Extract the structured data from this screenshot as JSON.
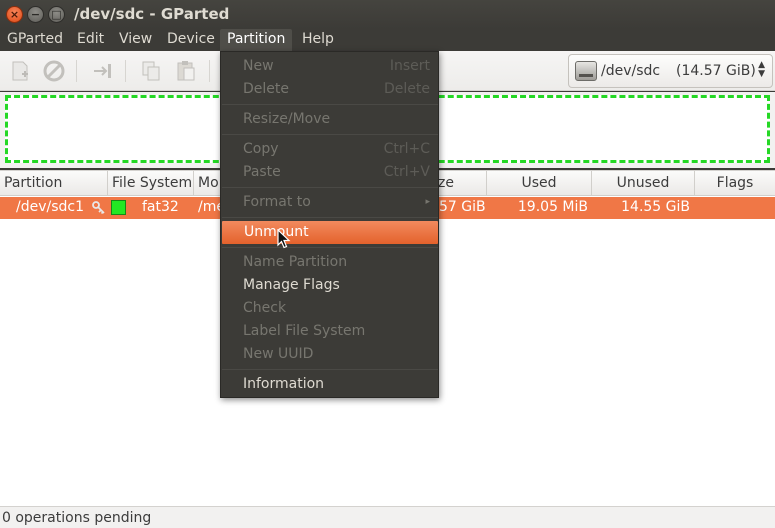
{
  "window": {
    "title": "/dev/sdc - GParted",
    "close_glyph": "×",
    "minimize_glyph": "−",
    "maximize_glyph": "□"
  },
  "menubar": [
    "GParted",
    "Edit",
    "View",
    "Device",
    "Partition",
    "Help"
  ],
  "toolbar": {
    "icons": [
      "new-partition-icon",
      "delete-icon",
      "resize-move-icon",
      "copy-icon",
      "paste-icon"
    ]
  },
  "device_selector": {
    "device": "/dev/sdc",
    "size": "(14.57 GiB)"
  },
  "table": {
    "columns": [
      "Partition",
      "File System",
      "Mo",
      "ze",
      "Used",
      "Unused",
      "Flags"
    ],
    "rows": [
      {
        "partition": "/dev/sdc1",
        "filesystem": "fat32",
        "mountpoint": "/me",
        "size": "57 GiB",
        "used": "19.05 MiB",
        "unused": "14.55 GiB",
        "flags": ""
      }
    ]
  },
  "partition_menu": {
    "new": {
      "label": "New",
      "accel": "Insert"
    },
    "delete": {
      "label": "Delete",
      "accel": "Delete"
    },
    "resize": {
      "label": "Resize/Move"
    },
    "copy": {
      "label": "Copy",
      "accel": "Ctrl+C"
    },
    "paste": {
      "label": "Paste",
      "accel": "Ctrl+V"
    },
    "format": {
      "label": "Format to"
    },
    "unmount": {
      "label": "Unmount"
    },
    "name": {
      "label": "Name Partition"
    },
    "flags": {
      "label": "Manage Flags"
    },
    "check": {
      "label": "Check"
    },
    "label_fs": {
      "label": "Label File System"
    },
    "uuid": {
      "label": "New UUID"
    },
    "info": {
      "label": "Information"
    }
  },
  "statusbar": {
    "text": "0 operations pending"
  },
  "colors": {
    "accent": "#f07746",
    "filesystem_fat32": "#23e823"
  }
}
